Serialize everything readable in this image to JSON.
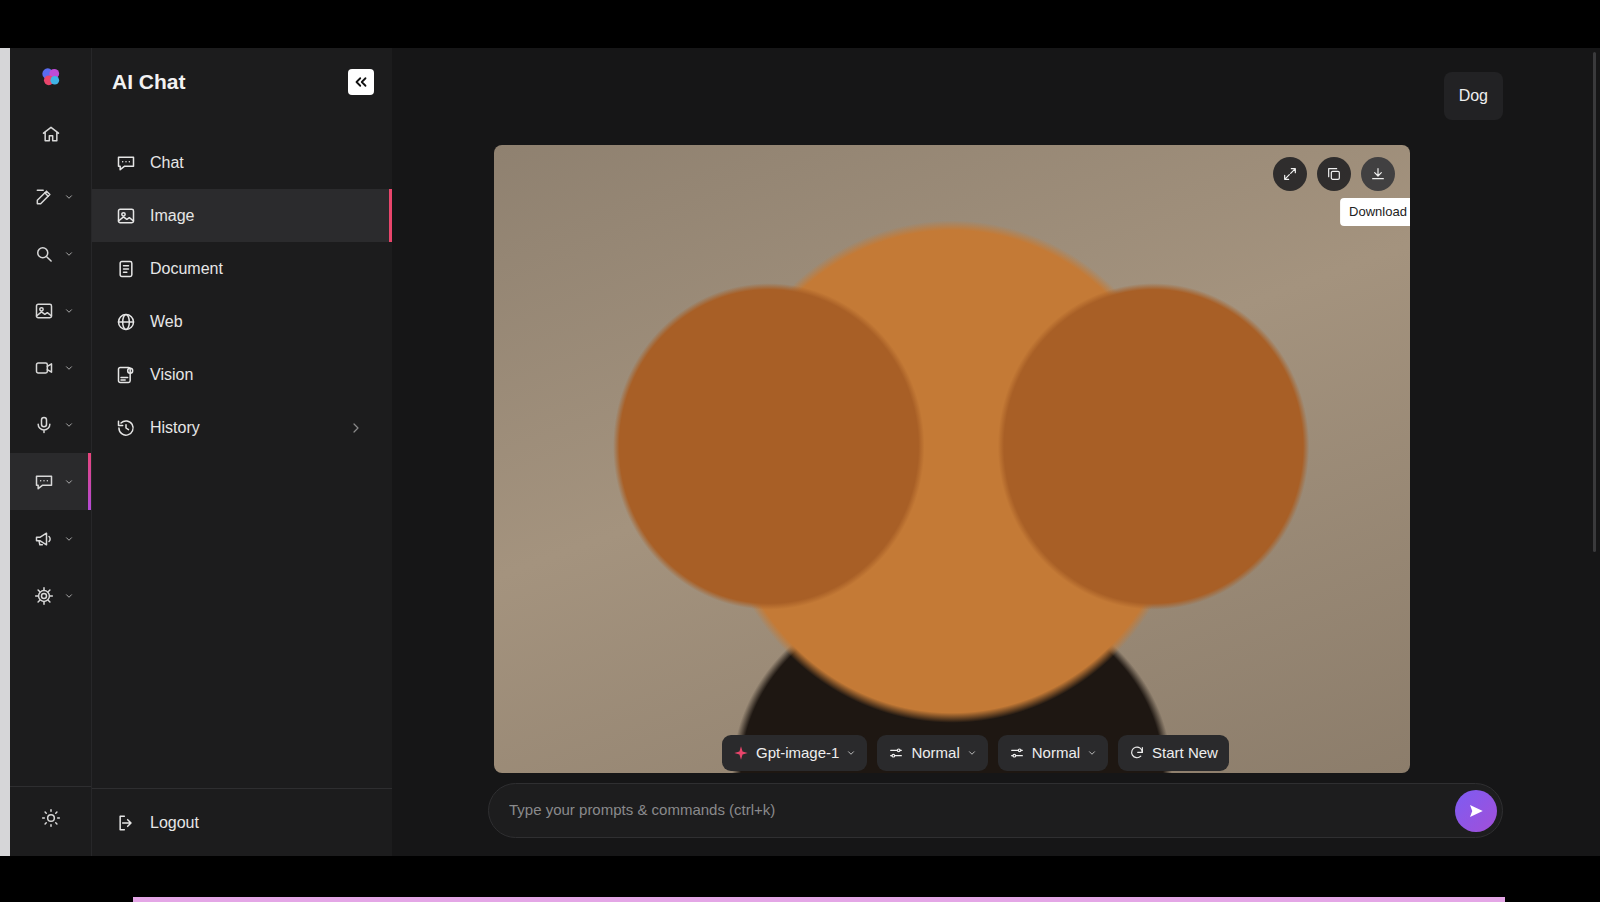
{
  "rail": {
    "items": [
      {
        "kind": "logo",
        "selected": false,
        "has_menu": false
      },
      {
        "kind": "home",
        "selected": false,
        "has_menu": false
      },
      {
        "kind": "edit",
        "selected": false,
        "has_menu": true
      },
      {
        "kind": "search",
        "selected": false,
        "has_menu": true
      },
      {
        "kind": "image",
        "selected": false,
        "has_menu": true
      },
      {
        "kind": "video",
        "selected": false,
        "has_menu": true
      },
      {
        "kind": "mic",
        "selected": false,
        "has_menu": true
      },
      {
        "kind": "chat",
        "selected": true,
        "has_menu": true
      },
      {
        "kind": "megaphone",
        "selected": false,
        "has_menu": true
      },
      {
        "kind": "settings",
        "selected": false,
        "has_menu": true
      }
    ]
  },
  "sidebar": {
    "title": "AI Chat",
    "items": [
      {
        "label": "Chat",
        "kind": "chat",
        "selected": false,
        "expandable": false
      },
      {
        "label": "Image",
        "kind": "image",
        "selected": true,
        "expandable": false
      },
      {
        "label": "Document",
        "kind": "document",
        "selected": false,
        "expandable": false
      },
      {
        "label": "Web",
        "kind": "web",
        "selected": false,
        "expandable": false
      },
      {
        "label": "Vision",
        "kind": "vision",
        "selected": false,
        "expandable": false
      },
      {
        "label": "History",
        "kind": "history",
        "selected": false,
        "expandable": true
      }
    ],
    "logout": "Logout"
  },
  "conversation": {
    "title": "Dog"
  },
  "image": {
    "actions": [
      {
        "kind": "expand",
        "hovered": false
      },
      {
        "kind": "copy",
        "hovered": false
      },
      {
        "kind": "download",
        "hovered": true
      }
    ],
    "tooltip": "Download",
    "options": [
      {
        "label": "Gpt-image-1",
        "kind": "model"
      },
      {
        "label": "Normal",
        "kind": "select"
      },
      {
        "label": "Normal",
        "kind": "select"
      },
      {
        "label": "Start New",
        "kind": "action"
      }
    ]
  },
  "composer": {
    "placeholder": "Type your prompts & commands (ctrl+k)"
  }
}
